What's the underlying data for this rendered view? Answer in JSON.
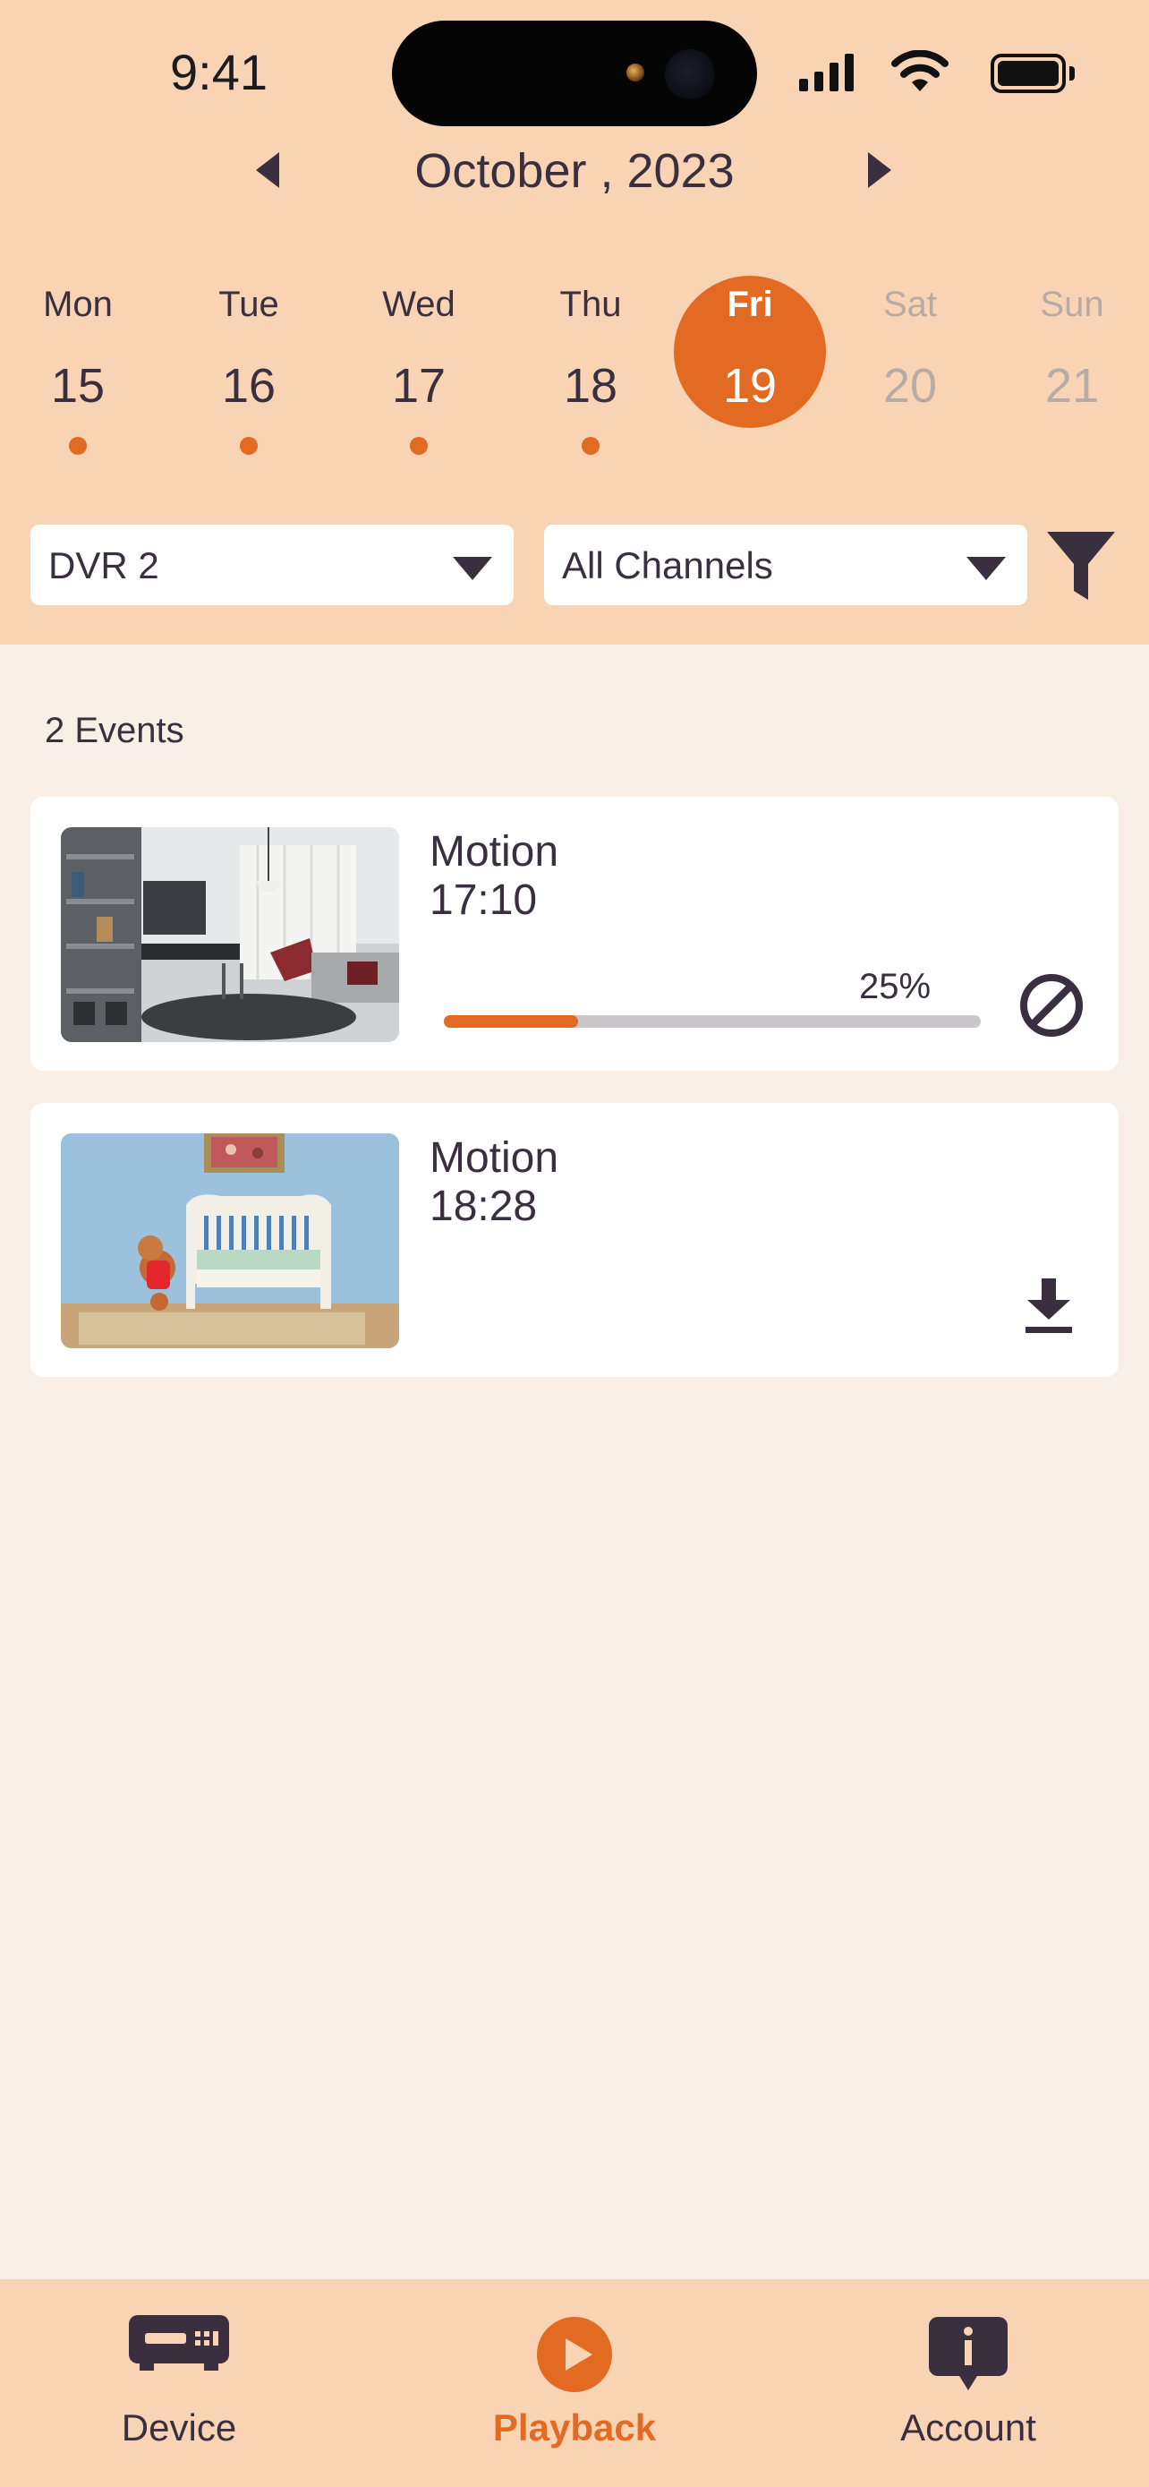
{
  "status_bar": {
    "time": "9:41"
  },
  "calendar": {
    "month_title": "October , 2023",
    "days": [
      {
        "name": "Mon",
        "num": "15",
        "has_events": true,
        "state": "past"
      },
      {
        "name": "Tue",
        "num": "16",
        "has_events": true,
        "state": "past"
      },
      {
        "name": "Wed",
        "num": "17",
        "has_events": true,
        "state": "past"
      },
      {
        "name": "Thu",
        "num": "18",
        "has_events": true,
        "state": "past"
      },
      {
        "name": "Fri",
        "num": "19",
        "has_events": false,
        "state": "selected"
      },
      {
        "name": "Sat",
        "num": "20",
        "has_events": false,
        "state": "future"
      },
      {
        "name": "Sun",
        "num": "21",
        "has_events": false,
        "state": "future"
      }
    ]
  },
  "filters": {
    "device": "DVR 2",
    "channel": "All Channels"
  },
  "events": {
    "count_label": "2 Events",
    "items": [
      {
        "type": "Motion",
        "time": "17:10",
        "progress_pct": 25,
        "progress_label": "25%",
        "action_icon": "cancel-icon"
      },
      {
        "type": "Motion",
        "time": "18:28",
        "action_icon": "download-icon"
      }
    ]
  },
  "tabs": [
    {
      "label": "Device",
      "icon": "dvr-icon",
      "active": false
    },
    {
      "label": "Playback",
      "icon": "play-icon",
      "active": true
    },
    {
      "label": "Account",
      "icon": "info-bubble-icon",
      "active": false
    }
  ],
  "colors": {
    "accent": "#e26a22",
    "header_bg": "#f8d4b5",
    "page_bg": "#faefe6",
    "text": "#3a2f3f"
  }
}
